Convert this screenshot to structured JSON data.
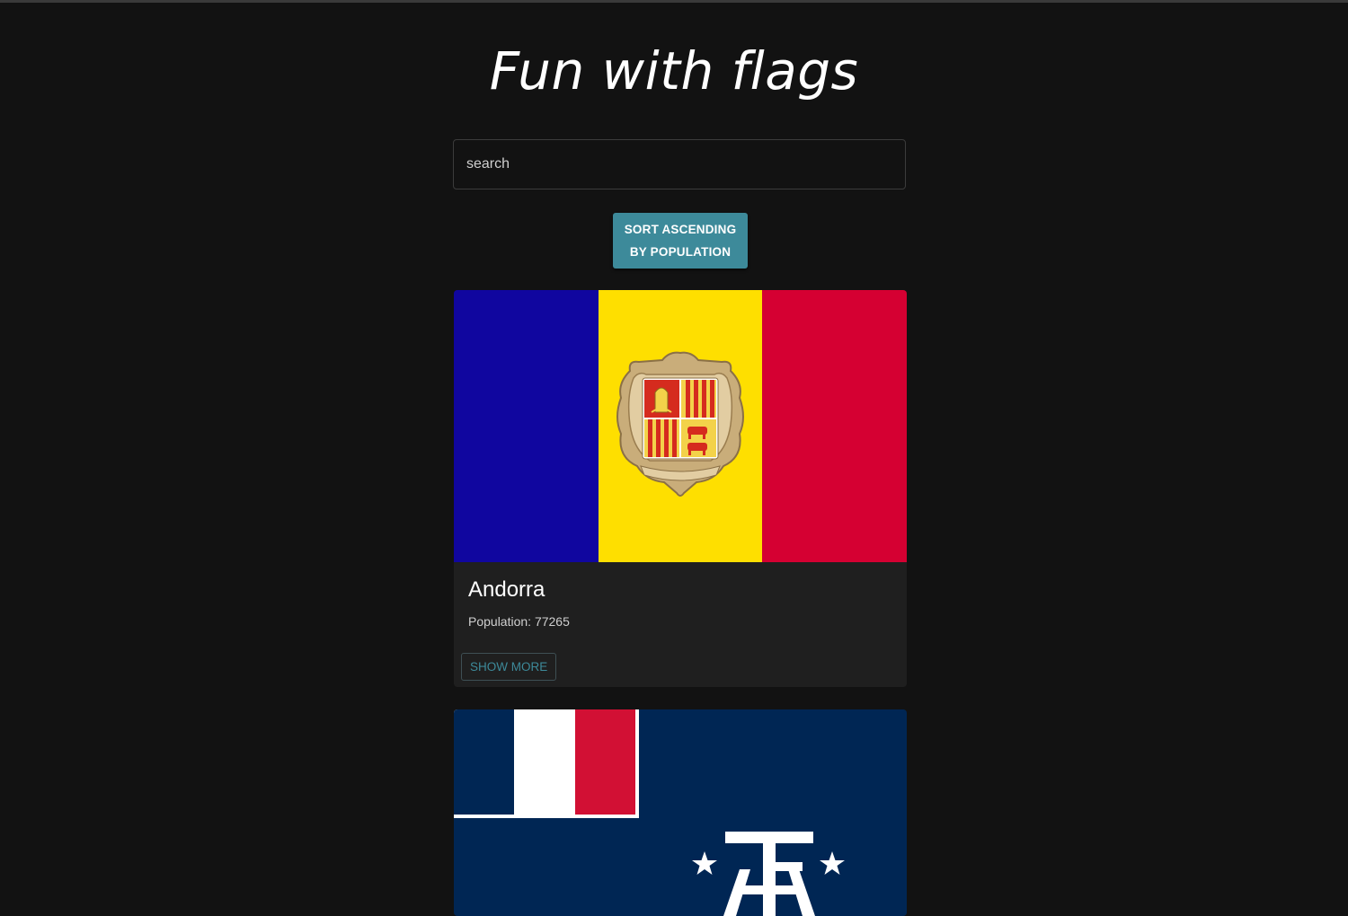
{
  "header": {
    "title": "Fun with flags"
  },
  "search": {
    "placeholder": "search",
    "value": ""
  },
  "sort_button": {
    "label": "SORT ASCENDING BY POPULATION"
  },
  "countries": [
    {
      "name": "Andorra",
      "population_text": "Population: 77265",
      "show_more_label": "SHOW MORE",
      "flag_icon": "andorra-flag",
      "flag_colors": [
        "#10069f",
        "#fedf00",
        "#d50032"
      ]
    },
    {
      "flag_icon": "french-southern-territories-flag",
      "flag_colors": [
        "#002395",
        "#ffffff",
        "#ed2939"
      ]
    }
  ],
  "colors": {
    "background": "#121212",
    "card": "#1f1f1f",
    "accent": "#3d8a9a"
  }
}
